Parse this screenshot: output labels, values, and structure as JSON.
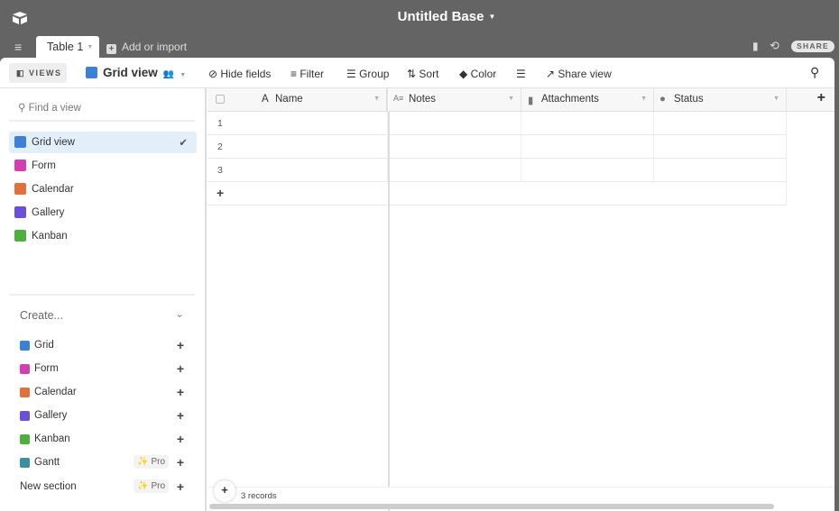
{
  "base": {
    "title": "Untitled Base",
    "tab": "Table 1",
    "add_import": "Add or import",
    "share": "SHARE"
  },
  "toolbar": {
    "views": "VIEWS",
    "view_name": "Grid view",
    "hide_fields": "Hide fields",
    "filter": "Filter",
    "group": "Group",
    "sort": "Sort",
    "color": "Color",
    "share_view": "Share view"
  },
  "sidebar": {
    "search_placeholder": "Find a view",
    "views": [
      {
        "label": "Grid view",
        "color": "#3b82d6",
        "selected": true
      },
      {
        "label": "Form",
        "color": "#d33fb1"
      },
      {
        "label": "Calendar",
        "color": "#e2703a"
      },
      {
        "label": "Gallery",
        "color": "#6b4fd8"
      },
      {
        "label": "Kanban",
        "color": "#4caf3e"
      }
    ],
    "create_label": "Create...",
    "create": [
      {
        "label": "Grid",
        "color": "#3b82d6"
      },
      {
        "label": "Form",
        "color": "#d33fb1"
      },
      {
        "label": "Calendar",
        "color": "#e2703a"
      },
      {
        "label": "Gallery",
        "color": "#6b4fd8"
      },
      {
        "label": "Kanban",
        "color": "#4caf3e"
      },
      {
        "label": "Gantt",
        "color": "#3a8fa3",
        "pro": "Pro"
      }
    ],
    "new_section": "New section",
    "new_section_pro": "Pro"
  },
  "grid": {
    "columns": [
      "Name",
      "Notes",
      "Attachments",
      "Status"
    ],
    "rows": [
      "1",
      "2",
      "3"
    ],
    "records": "3 records"
  }
}
